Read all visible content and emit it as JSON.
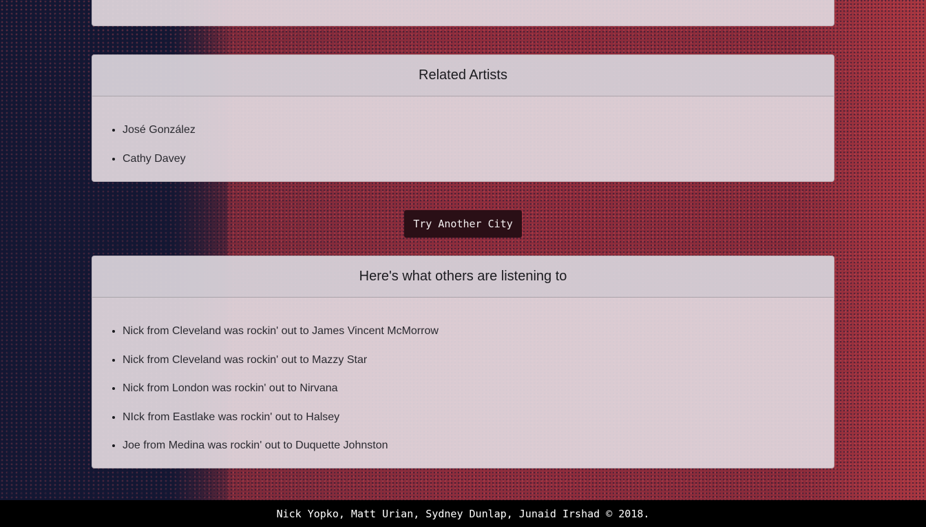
{
  "related_artists": {
    "title": "Related Artists",
    "items": [
      "José González",
      "Cathy Davey"
    ]
  },
  "try_button": {
    "label": "Try Another City"
  },
  "others": {
    "title": "Here's what others are listening to",
    "items": [
      "Nick from Cleveland was rockin' out to James Vincent McMorrow",
      "Nick from Cleveland was rockin' out to Mazzy Star",
      "Nick from London was rockin' out to Nirvana",
      "NIck from Eastlake was rockin' out to Halsey",
      "Joe from Medina was rockin' out to Duquette Johnston"
    ]
  },
  "footer": {
    "text": "Nick Yopko, Matt Urian, Sydney Dunlap, Junaid Irshad © 2018."
  },
  "colors": {
    "card_bg": "#e1d7de",
    "button_bg": "#2a0f16",
    "footer_bg": "#000000",
    "page_dark": "#131733",
    "page_red": "#8f2d3c"
  }
}
